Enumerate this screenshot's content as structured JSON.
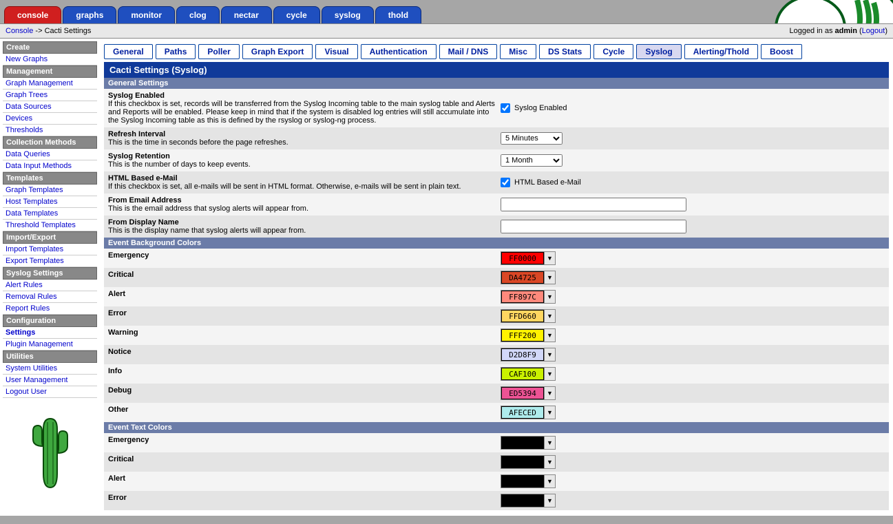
{
  "topTabs": [
    "console",
    "graphs",
    "monitor",
    "clog",
    "nectar",
    "cycle",
    "syslog",
    "thold"
  ],
  "activeTopTab": 0,
  "breadcrumb": {
    "root": "Console",
    "sep": " -> ",
    "current": "Cacti Settings"
  },
  "login": {
    "prefix": "Logged in as ",
    "user": "admin",
    "logout": "Logout"
  },
  "sidebar": [
    {
      "head": "Create"
    },
    {
      "link": "New Graphs"
    },
    {
      "head": "Management"
    },
    {
      "link": "Graph Management"
    },
    {
      "link": "Graph Trees"
    },
    {
      "link": "Data Sources"
    },
    {
      "link": "Devices"
    },
    {
      "link": "Thresholds"
    },
    {
      "head": "Collection Methods"
    },
    {
      "link": "Data Queries"
    },
    {
      "link": "Data Input Methods"
    },
    {
      "head": "Templates"
    },
    {
      "link": "Graph Templates"
    },
    {
      "link": "Host Templates"
    },
    {
      "link": "Data Templates"
    },
    {
      "link": "Threshold Templates"
    },
    {
      "head": "Import/Export"
    },
    {
      "link": "Import Templates"
    },
    {
      "link": "Export Templates"
    },
    {
      "head": "Syslog Settings"
    },
    {
      "link": "Alert Rules"
    },
    {
      "link": "Removal Rules"
    },
    {
      "link": "Report Rules"
    },
    {
      "head": "Configuration"
    },
    {
      "link": "Settings",
      "current": true
    },
    {
      "link": "Plugin Management"
    },
    {
      "head": "Utilities"
    },
    {
      "link": "System Utilities"
    },
    {
      "link": "User Management"
    },
    {
      "link": "Logout User"
    }
  ],
  "subTabs": [
    "General",
    "Paths",
    "Poller",
    "Graph Export",
    "Visual",
    "Authentication",
    "Mail / DNS",
    "Misc",
    "DS Stats",
    "Cycle",
    "Syslog",
    "Alerting/Thold",
    "Boost"
  ],
  "activeSubTab": 10,
  "panelTitle": "Cacti Settings (Syslog)",
  "sections": {
    "general": {
      "head": "General Settings",
      "syslogEnabled": {
        "title": "Syslog Enabled",
        "desc": "If this checkbox is set, records will be transferred from the Syslog Incoming table to the main syslog table and Alerts and Reports will be enabled. Please keep in mind that if the system is disabled log entries will still accumulate into the Syslog Incoming table as this is defined by the rsyslog or syslog-ng process.",
        "label": "Syslog Enabled",
        "checked": true
      },
      "refresh": {
        "title": "Refresh Interval",
        "desc": "This is the time in seconds before the page refreshes.",
        "value": "5 Minutes"
      },
      "retention": {
        "title": "Syslog Retention",
        "desc": "This is the number of days to keep events.",
        "value": "1 Month"
      },
      "htmlMail": {
        "title": "HTML Based e-Mail",
        "desc": "If this checkbox is set, all e-mails will be sent in HTML format. Otherwise, e-mails will be sent in plain text.",
        "label": "HTML Based e-Mail",
        "checked": true
      },
      "fromEmail": {
        "title": "From Email Address",
        "desc": "This is the email address that syslog alerts will appear from.",
        "value": ""
      },
      "fromName": {
        "title": "From Display Name",
        "desc": "This is the display name that syslog alerts will appear from.",
        "value": ""
      }
    },
    "bgColors": {
      "head": "Event Background Colors",
      "rows": [
        {
          "label": "Emergency",
          "color": "FF0000",
          "textColor": "#000"
        },
        {
          "label": "Critical",
          "color": "DA4725",
          "textColor": "#000"
        },
        {
          "label": "Alert",
          "color": "FF897C",
          "textColor": "#000"
        },
        {
          "label": "Error",
          "color": "FFD660",
          "textColor": "#000"
        },
        {
          "label": "Warning",
          "color": "FFF200",
          "textColor": "#000"
        },
        {
          "label": "Notice",
          "color": "D2D8F9",
          "textColor": "#000"
        },
        {
          "label": "Info",
          "color": "CAF100",
          "textColor": "#000"
        },
        {
          "label": "Debug",
          "color": "ED5394",
          "textColor": "#000"
        },
        {
          "label": "Other",
          "color": "AFECED",
          "textColor": "#000"
        }
      ]
    },
    "txtColors": {
      "head": "Event Text Colors",
      "rows": [
        {
          "label": "Emergency",
          "color": "000000"
        },
        {
          "label": "Critical",
          "color": "000000"
        },
        {
          "label": "Alert",
          "color": "000000"
        },
        {
          "label": "Error",
          "color": "000000"
        }
      ]
    }
  }
}
